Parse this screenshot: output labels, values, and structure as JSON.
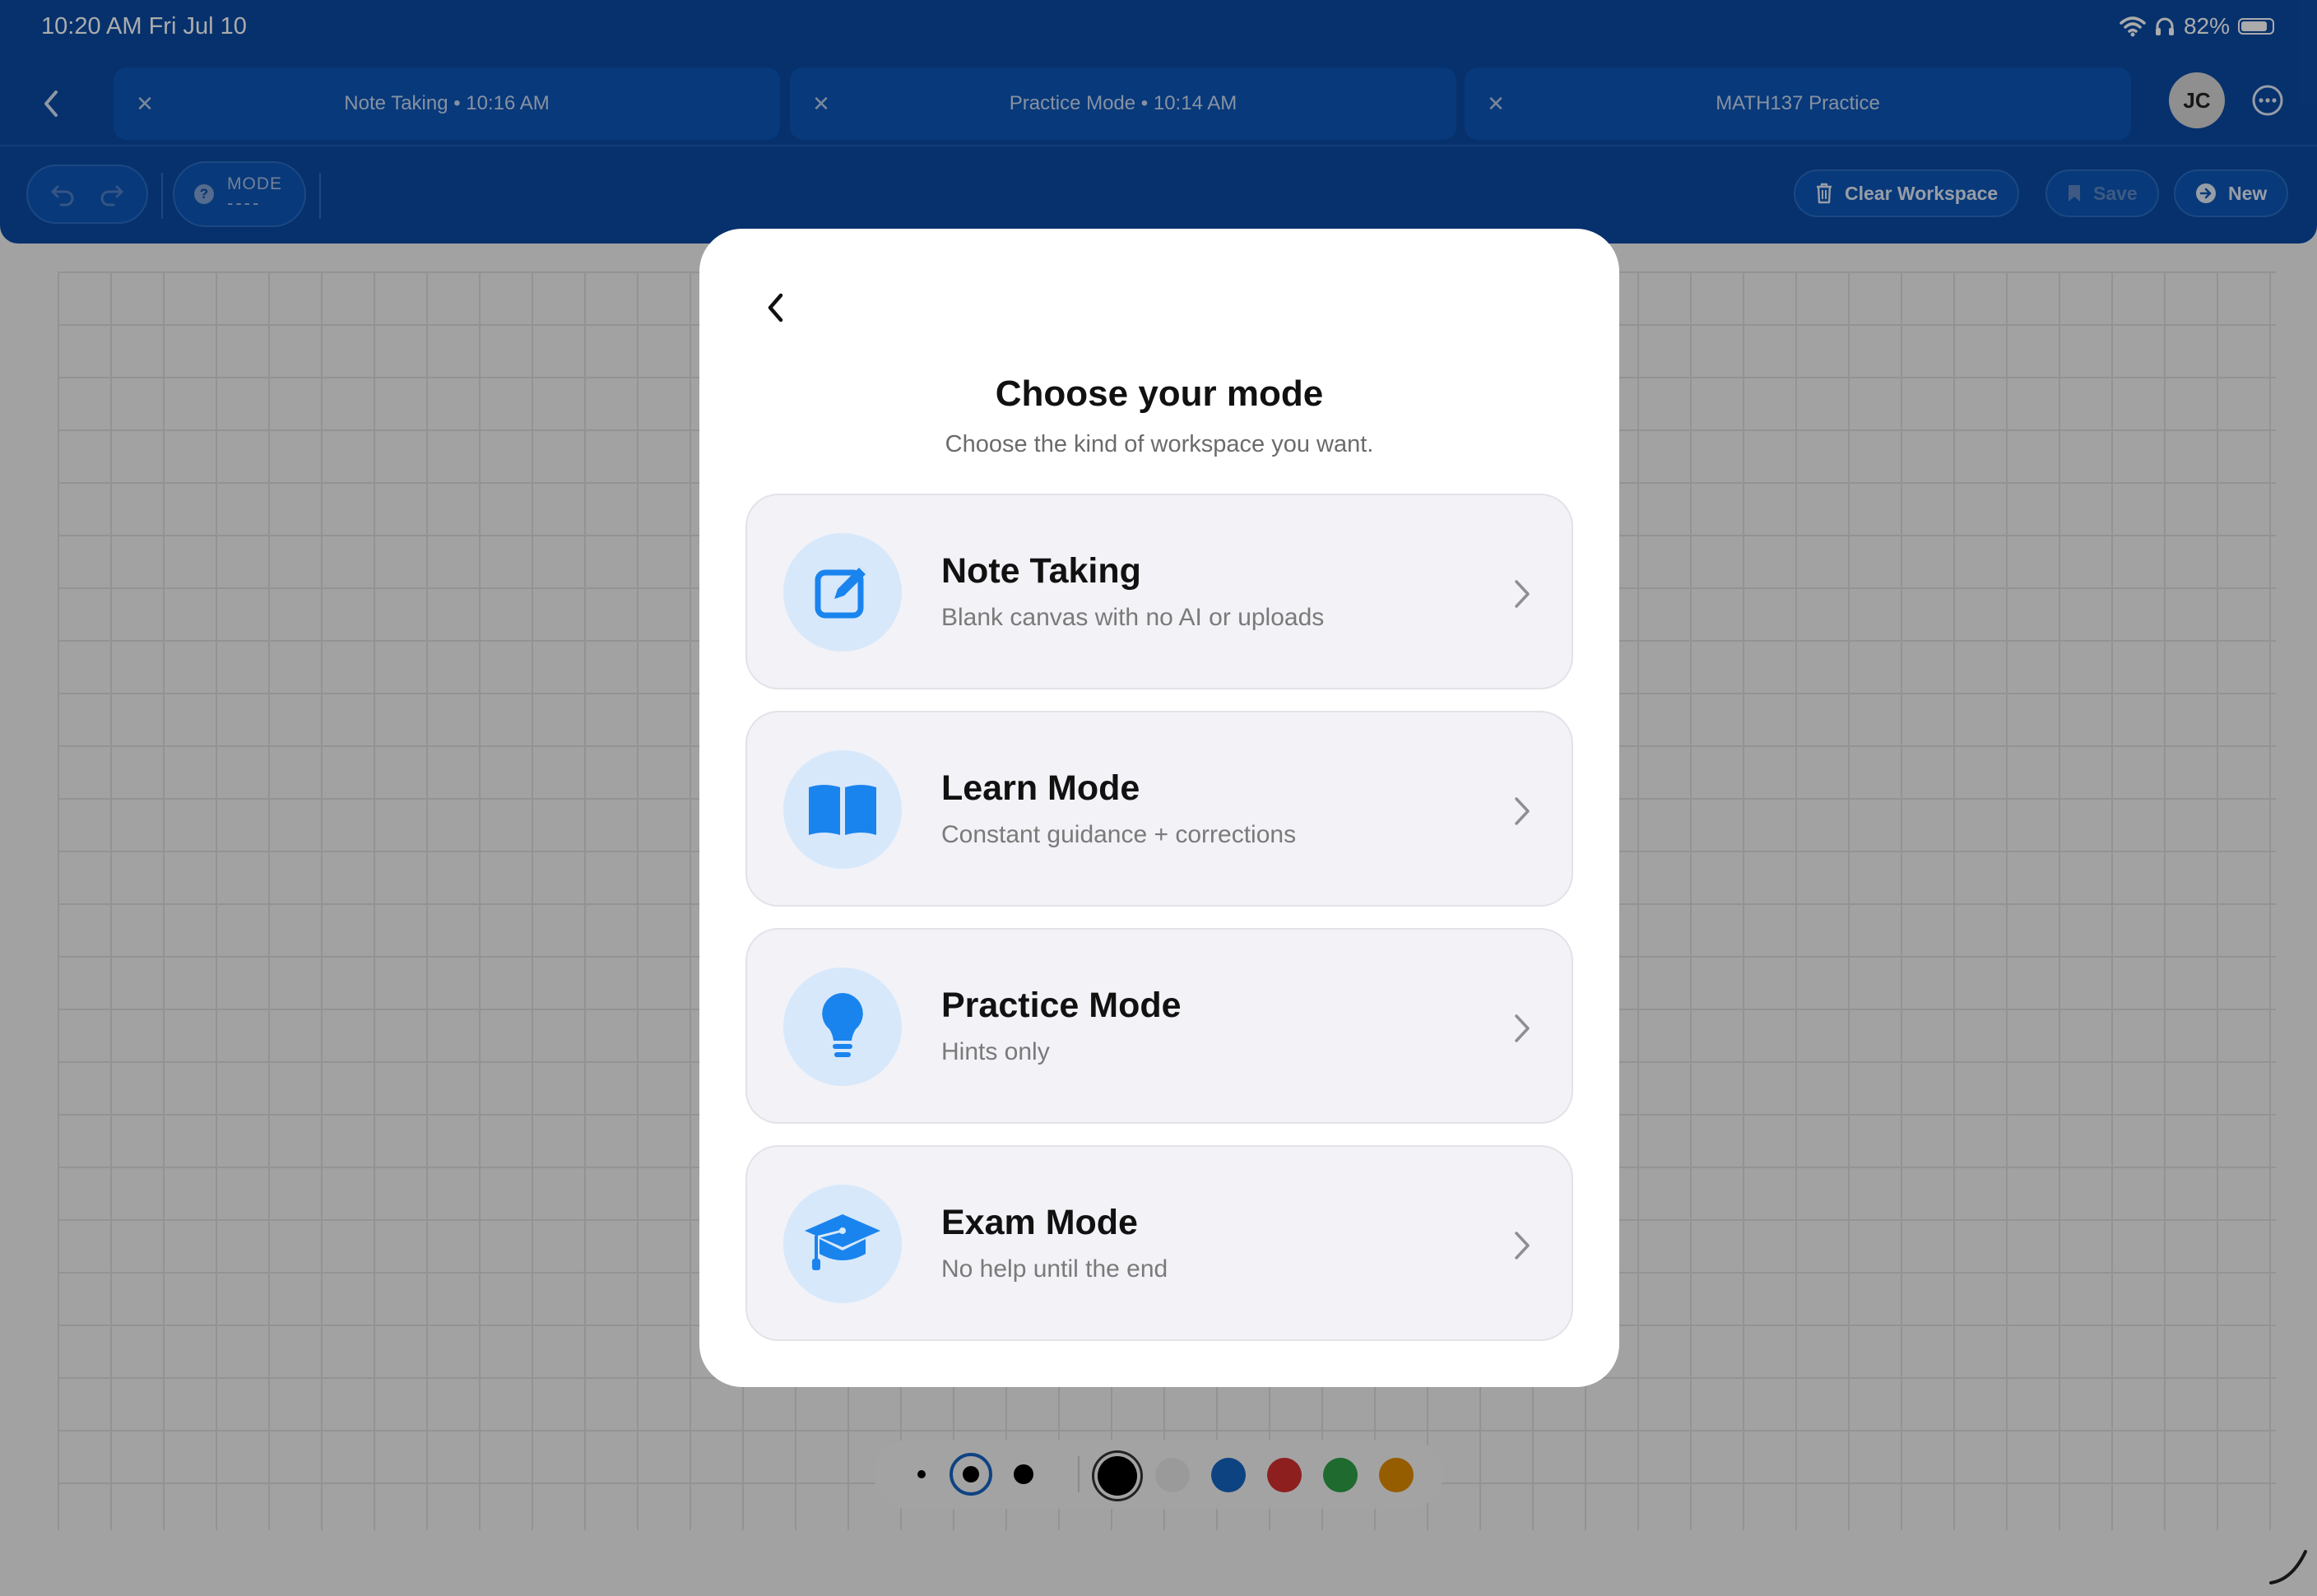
{
  "status": {
    "time": "10:20 AM   Fri Jul 10",
    "battery": "82%"
  },
  "tabs": [
    {
      "label": "Note Taking • 10:16 AM"
    },
    {
      "label": "Practice Mode • 10:14 AM"
    },
    {
      "label": "MATH137 Practice"
    }
  ],
  "user": {
    "initials": "JC"
  },
  "toolbar": {
    "mode_label": "MODE",
    "mode_value": "----",
    "clear_label": "Clear Workspace",
    "save_label": "Save",
    "new_label": "New"
  },
  "modal": {
    "title": "Choose your mode",
    "subtitle": "Choose the kind of workspace you want.",
    "options": [
      {
        "title": "Note Taking",
        "desc": "Blank canvas with no AI or uploads",
        "icon": "edit-icon"
      },
      {
        "title": "Learn Mode",
        "desc": "Constant guidance + corrections",
        "icon": "book-icon"
      },
      {
        "title": "Practice Mode",
        "desc": "Hints only",
        "icon": "lightbulb-icon"
      },
      {
        "title": "Exam Mode",
        "desc": "No help until the end",
        "icon": "graduation-cap-icon"
      }
    ]
  },
  "palette": {
    "colors": [
      "#000000",
      "#e6e6e6",
      "#1565c0",
      "#d32f2f",
      "#2e9e46",
      "#e08a00"
    ],
    "selected_color": "#000000"
  },
  "theme": {
    "accent": "#0a4aa3",
    "icon_blue": "#1a84ee"
  }
}
